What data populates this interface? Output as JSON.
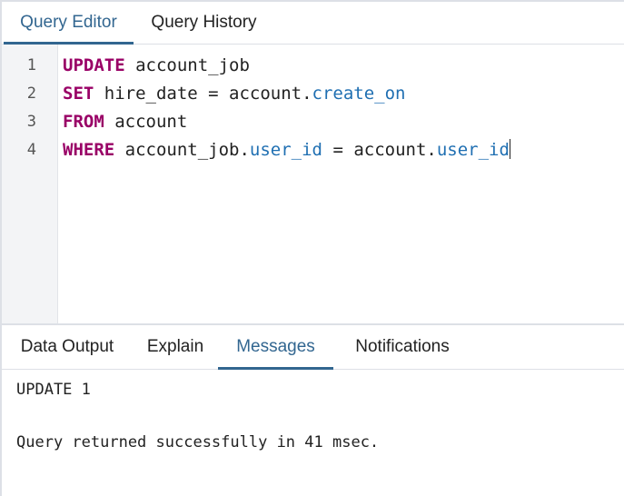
{
  "top_tabs": [
    {
      "label": "Query Editor",
      "active": true
    },
    {
      "label": "Query History",
      "active": false
    }
  ],
  "editor": {
    "line_numbers": [
      "1",
      "2",
      "3",
      "4"
    ],
    "lines": [
      {
        "tokens": [
          {
            "t": "UPDATE",
            "k": "kw"
          },
          {
            "t": " account_job",
            "k": "plain"
          }
        ]
      },
      {
        "tokens": [
          {
            "t": "SET",
            "k": "kw"
          },
          {
            "t": " hire_date = account.",
            "k": "plain"
          },
          {
            "t": "create_on",
            "k": "prop"
          }
        ]
      },
      {
        "tokens": [
          {
            "t": "FROM",
            "k": "kw"
          },
          {
            "t": " account",
            "k": "plain"
          }
        ]
      },
      {
        "tokens": [
          {
            "t": "WHERE",
            "k": "kw"
          },
          {
            "t": " account_job.",
            "k": "plain"
          },
          {
            "t": "user_id",
            "k": "prop"
          },
          {
            "t": " = account.",
            "k": "plain"
          },
          {
            "t": "user_id",
            "k": "prop"
          }
        ]
      }
    ]
  },
  "bottom_tabs": [
    {
      "label": "Data Output",
      "active": false
    },
    {
      "label": "Explain",
      "active": false
    },
    {
      "label": "Messages",
      "active": true
    },
    {
      "label": "Notifications",
      "active": false
    }
  ],
  "messages": {
    "line1": "UPDATE 1",
    "line2": "Query returned successfully in 41 msec."
  },
  "colors": {
    "accent": "#326690",
    "keyword": "#990066",
    "property": "#1f6fb2"
  }
}
